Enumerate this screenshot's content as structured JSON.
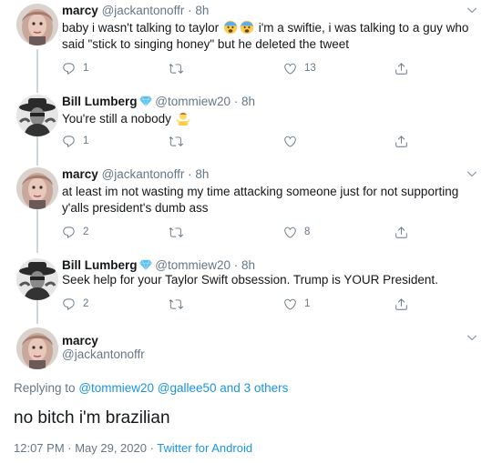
{
  "tweets": [
    {
      "name": "marcy",
      "handle": "@jackantonoffr",
      "time": "8h",
      "text_before_emoji": "baby i wasn't talking to taylor",
      "emoji_name": "fearful-face-emoji",
      "text_after_emoji": " i'm a swiftie, i was talking to a guy who",
      "text_line2": "said \"stick to singing honey\" but he deleted the tweet",
      "replies": "1",
      "retweets": "",
      "likes": "13"
    },
    {
      "name": "Bill Lumberg",
      "handle": "@tommiew20",
      "time": "8h",
      "text": "You're still a nobody",
      "emoji_name": "person-shrugging-emoji",
      "replies": "1",
      "retweets": "",
      "likes": ""
    },
    {
      "name": "marcy",
      "handle": "@jackantonoffr",
      "time": "8h",
      "text_line1": "at least im not wasting my time attacking someone just for not supporting",
      "text_line2": "y'alls president's dumb ass",
      "replies": "2",
      "retweets": "",
      "likes": "8"
    },
    {
      "name": "Bill Lumberg",
      "handle": "@tommiew20",
      "time": "8h",
      "text": "Seek help for your Taylor Swift obsession. Trump is YOUR President.",
      "replies": "2",
      "retweets": "",
      "likes": "1"
    }
  ],
  "main_tweet": {
    "name": "marcy",
    "handle": "@jackantonoffr",
    "replying_prefix": "Replying to",
    "replying_to": "@tommiew20 @gallee50 and 3 others",
    "text": "no bitch i'm brazilian",
    "timestamp": "12:07 PM · May 29, 2020 · ",
    "source": "Twitter for Android"
  },
  "separator": " · ",
  "colors": {
    "text": "#14171a",
    "secondary": "#657786",
    "link": "#1b95e0",
    "thread_line": "#ccd6dd",
    "verified": "#5bc0f0"
  }
}
